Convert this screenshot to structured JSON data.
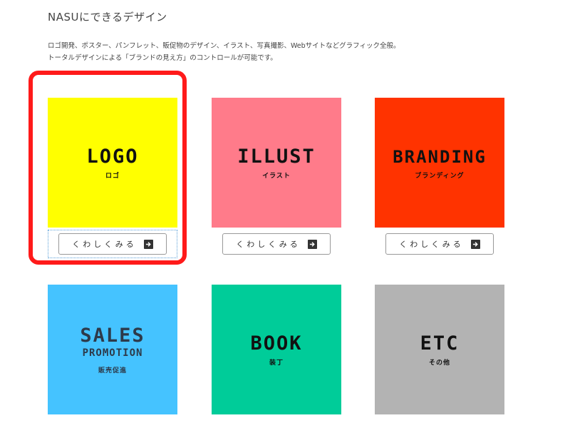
{
  "section": {
    "heading": "NASUにできるデザイン",
    "description_lines": [
      "ロゴ開発、ポスター、パンフレット、販促物のデザイン、イラスト、写真撮影、Webサイトなどグラフィック全般。",
      "トータルデザインによる「ブランドの見え方」のコントロールが可能です。"
    ]
  },
  "cards": [
    {
      "title": "LOGO",
      "subtitle": "ロゴ",
      "color": "#ffff00",
      "button_label": "くわしくみる"
    },
    {
      "title": "ILLUST",
      "subtitle": "イラスト",
      "color": "#ff7b8a",
      "button_label": "くわしくみる"
    },
    {
      "title": "BRANDING",
      "subtitle": "ブランディング",
      "color": "#ff3300",
      "button_label": "くわしくみる"
    },
    {
      "title": "SALES",
      "title2": "PROMOTION",
      "subtitle": "販売促進",
      "color": "#45c3ff"
    },
    {
      "title": "BOOK",
      "subtitle": "装丁",
      "color": "#00cc99"
    },
    {
      "title": "ETC",
      "subtitle": "その他",
      "color": "#b3b3b3"
    }
  ],
  "icons": {
    "button_arrow": "arrow-right-icon"
  },
  "highlight_color": "#ff1a1a"
}
